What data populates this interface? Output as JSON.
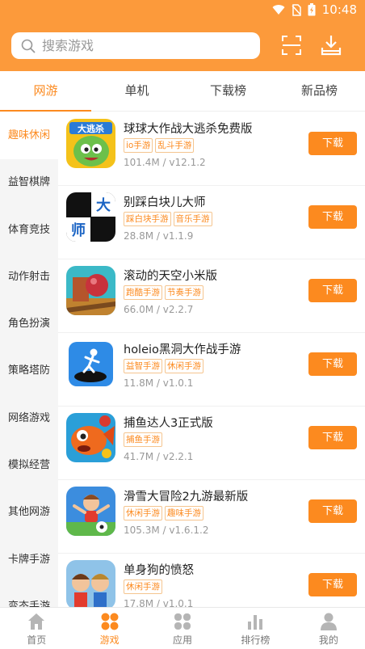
{
  "status": {
    "time": "10:48"
  },
  "search": {
    "placeholder": "搜索游戏"
  },
  "top_tabs": [
    {
      "label": "网游",
      "active": true
    },
    {
      "label": "单机"
    },
    {
      "label": "下载榜"
    },
    {
      "label": "新品榜"
    }
  ],
  "sidebar": {
    "items": [
      {
        "label": "趣味休闲",
        "active": true
      },
      {
        "label": "益智棋牌"
      },
      {
        "label": "体育竞技"
      },
      {
        "label": "动作射击"
      },
      {
        "label": "角色扮演"
      },
      {
        "label": "策略塔防"
      },
      {
        "label": "网络游戏"
      },
      {
        "label": "模拟经营"
      },
      {
        "label": "其他网游"
      },
      {
        "label": "卡牌手游"
      },
      {
        "label": "变态手游"
      }
    ]
  },
  "apps": [
    {
      "name": "球球大作战大逃杀免费版",
      "tags": [
        "io手游",
        "乱斗手游"
      ],
      "meta": "101.4M / v12.1.2",
      "button": "下载",
      "icon": "ball-battle-icon",
      "icon_bg": "#F4C21A",
      "icon_text": "大逃杀"
    },
    {
      "name": "别踩白块儿大师",
      "tags": [
        "踩白块手游",
        "音乐手游"
      ],
      "meta": "28.8M / v1.1.9",
      "button": "下载",
      "icon": "piano-tiles-icon",
      "icon_bg": "#111111",
      "icon_text": "大师"
    },
    {
      "name": "滚动的天空小米版",
      "tags": [
        "跑酷手游",
        "节奏手游"
      ],
      "meta": "66.0M / v2.2.7",
      "button": "下载",
      "icon": "rolling-sky-icon",
      "icon_bg": "#3BB9C7"
    },
    {
      "name": "holeio黑洞大作战手游",
      "tags": [
        "益智手游",
        "休闲手游"
      ],
      "meta": "11.8M / v1.0.1",
      "button": "下载",
      "icon": "hole-io-icon",
      "icon_bg": "#2E8BE6"
    },
    {
      "name": "捕鱼达人3正式版",
      "tags": [
        "捕鱼手游"
      ],
      "meta": "41.7M / v2.2.1",
      "button": "下载",
      "icon": "fishing-icon",
      "icon_bg": "#2A9FD8"
    },
    {
      "name": "滑雪大冒险2九游最新版",
      "tags": [
        "休闲手游",
        "趣味手游"
      ],
      "meta": "105.3M / v1.6.1.2",
      "button": "下载",
      "icon": "ski-safari-icon",
      "icon_bg": "#3C8DDE"
    },
    {
      "name": "单身狗的愤怒",
      "tags": [
        "休闲手游"
      ],
      "meta": "17.8M / v1.0.1",
      "button": "下载",
      "icon": "single-dog-icon",
      "icon_bg": "#8FC3E8"
    }
  ],
  "bottom_nav": [
    {
      "label": "首页",
      "icon": "home-icon"
    },
    {
      "label": "游戏",
      "icon": "games-icon",
      "active": true
    },
    {
      "label": "应用",
      "icon": "apps-icon"
    },
    {
      "label": "排行榜",
      "icon": "ranking-icon"
    },
    {
      "label": "我的",
      "icon": "profile-icon"
    }
  ],
  "colors": {
    "accent": "#FC8A1F",
    "header": "#FC9A3B"
  }
}
